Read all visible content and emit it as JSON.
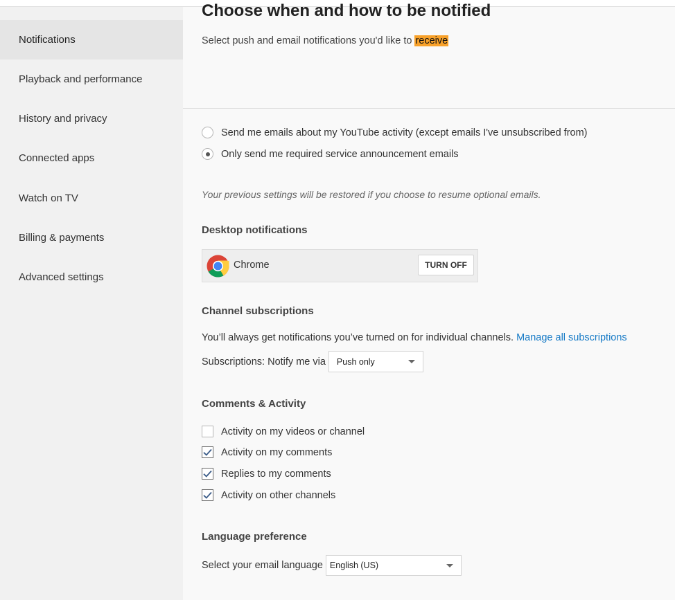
{
  "sidebar": {
    "items": [
      {
        "label": "Notifications",
        "active": true
      },
      {
        "label": "Playback and performance"
      },
      {
        "label": "History and privacy"
      },
      {
        "label": "Connected apps"
      },
      {
        "label": "Watch on TV"
      },
      {
        "label": "Billing & payments"
      },
      {
        "label": "Advanced settings"
      }
    ]
  },
  "header": {
    "title": "Choose when and how to be notified",
    "subtitle_prefix": "Select push and email notifications you'd like to ",
    "subtitle_highlight": "receive"
  },
  "email": {
    "options": [
      {
        "label": "Send me emails about my YouTube activity (except emails I've unsubscribed from)",
        "selected": false
      },
      {
        "label": "Only send me required service announcement emails",
        "selected": true
      }
    ],
    "note": "Your previous settings will be restored if you choose to resume optional emails."
  },
  "desktop": {
    "heading": "Desktop notifications",
    "browser_name": "Chrome",
    "browser_icon": "chrome-logo-icon",
    "turn_off_label": "TURN OFF"
  },
  "channels": {
    "heading": "Channel subscriptions",
    "description": "You’ll always get notifications you’ve turned on for individual channels. ",
    "manage_link": "Manage all subscriptions",
    "notify_label": "Subscriptions: Notify me via",
    "notify_value": "Push only"
  },
  "comments": {
    "heading": "Comments & Activity",
    "items": [
      {
        "label": "Activity on my videos or channel",
        "checked": false
      },
      {
        "label": "Activity on my comments",
        "checked": true
      },
      {
        "label": "Replies to my comments",
        "checked": true
      },
      {
        "label": "Activity on other channels",
        "checked": true
      }
    ]
  },
  "language": {
    "heading": "Language preference",
    "label": "Select your email language",
    "value": "English (US)"
  },
  "colors": {
    "highlight": "#f8a12a",
    "link": "#167ac6",
    "sidebar_bg": "#f1f1f1",
    "sidebar_active": "#e5e5e5"
  }
}
